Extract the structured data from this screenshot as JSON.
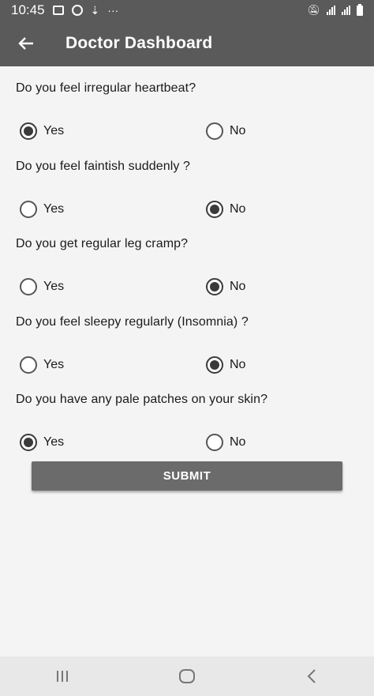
{
  "status_bar": {
    "time": "10:45",
    "dots": "···"
  },
  "app_bar": {
    "title": "Doctor Dashboard"
  },
  "questions": [
    {
      "text": "Do you feel irregular heartbeat?",
      "options": [
        "Yes",
        "No"
      ],
      "selected": "Yes"
    },
    {
      "text": "Do you feel faintish suddenly ?",
      "options": [
        "Yes",
        "No"
      ],
      "selected": "No"
    },
    {
      "text": "Do you get regular leg cramp?",
      "options": [
        "Yes",
        "No"
      ],
      "selected": "No"
    },
    {
      "text": "Do you feel sleepy regularly (Insomnia) ?",
      "options": [
        "Yes",
        "No"
      ],
      "selected": "No"
    },
    {
      "text": "Do you have any pale patches on your skin?",
      "options": [
        "Yes",
        "No"
      ],
      "selected": "Yes"
    }
  ],
  "submit_label": "SUBMIT",
  "colors": {
    "app_bar": "#5a5a5a",
    "button": "#6b6b6b",
    "background": "#f4f4f4"
  },
  "icons": {
    "back": "arrow-left-icon",
    "nav_recent": "recent-apps-icon",
    "nav_home": "home-icon",
    "nav_back": "chevron-left-icon"
  }
}
